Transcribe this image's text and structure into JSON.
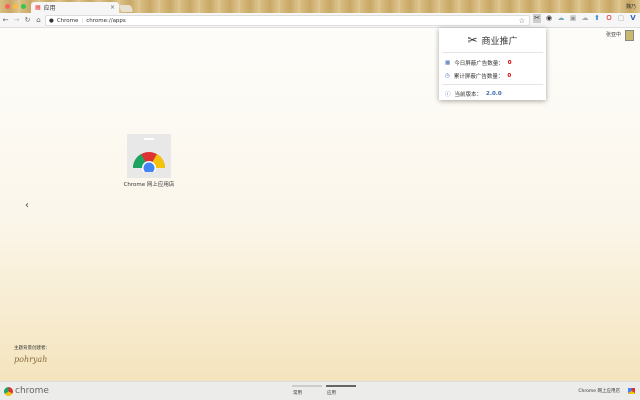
{
  "tab": {
    "title": "应用",
    "close": "×"
  },
  "profile_name": "魏乃",
  "omnibox": {
    "site_label": "Chrome",
    "url": "chrome://apps"
  },
  "popup": {
    "title": "商业推广",
    "rows": [
      {
        "label": "今日屏蔽广告数量：",
        "value": "0"
      },
      {
        "label": "累计屏蔽广告数量：",
        "value": "0"
      }
    ],
    "version_label": "当前版本：",
    "version": "2.0.0"
  },
  "user_label": "张亚中",
  "apps": [
    {
      "label": "Chrome 网上应用店"
    }
  ],
  "theme_credit": "主题背景创建者：",
  "theme_author": "pohryah",
  "footer": {
    "logo": "chrome",
    "pages": [
      "常用",
      "应用"
    ],
    "store_link": "Chrome 网上应用店"
  },
  "colors": {
    "accent": "#3568b0",
    "count": "#dd0000"
  }
}
